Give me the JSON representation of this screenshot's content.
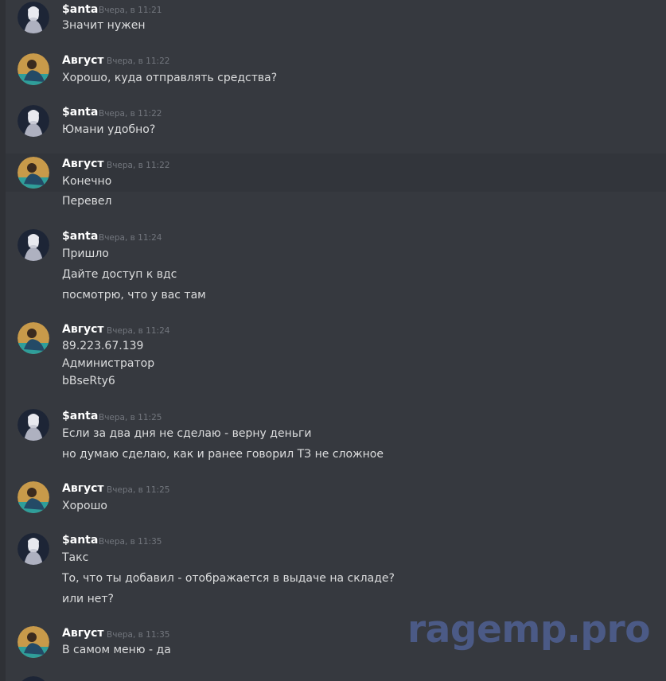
{
  "messages": [
    {
      "author": "$anta",
      "time": "Вчера, в 11:21",
      "lines": [
        "Значит нужен"
      ]
    },
    {
      "author": "Август",
      "time": "Вчера, в 11:22",
      "lines": [
        "Хорошо, куда отправлять средства?"
      ]
    },
    {
      "author": "$anta",
      "time": "Вчера, в 11:22",
      "lines": [
        "Юмани удобно?"
      ]
    },
    {
      "author": "Август",
      "time": "Вчера, в 11:22",
      "lines": [
        "Конечно",
        "Перевел"
      ]
    },
    {
      "author": "$anta",
      "time": "Вчера, в 11:24",
      "lines": [
        "Пришло",
        "Дайте доступ к вдс",
        "посмотрю, что у вас там"
      ]
    },
    {
      "author": "Август",
      "time": "Вчера, в 11:24",
      "lines": [
        "89.223.67.139",
        "Администратор",
        "bBseRty6"
      ]
    },
    {
      "author": "$anta",
      "time": "Вчера, в 11:25",
      "lines": [
        "Если за два дня не сделаю - верну деньги",
        "но думаю сделаю, как и ранее говорил ТЗ не сложное"
      ]
    },
    {
      "author": "Август",
      "time": "Вчера, в 11:25",
      "lines": [
        "Хорошо"
      ]
    },
    {
      "author": "$anta",
      "time": "Вчера, в 11:35",
      "lines": [
        "Такс",
        "То, что ты добавил - отображается в выдаче на складе?",
        "или нет?"
      ]
    },
    {
      "author": "Август",
      "time": "Вчера, в 11:35",
      "lines": [
        "В самом меню - да"
      ]
    }
  ],
  "watermark": "ragemp.pro",
  "colors": {
    "background": "#36393f",
    "hover_row": "#32353b",
    "author": "#ffffff",
    "text": "#dcddde",
    "timestamp": "#72767d",
    "watermark": "#4b5a86"
  }
}
